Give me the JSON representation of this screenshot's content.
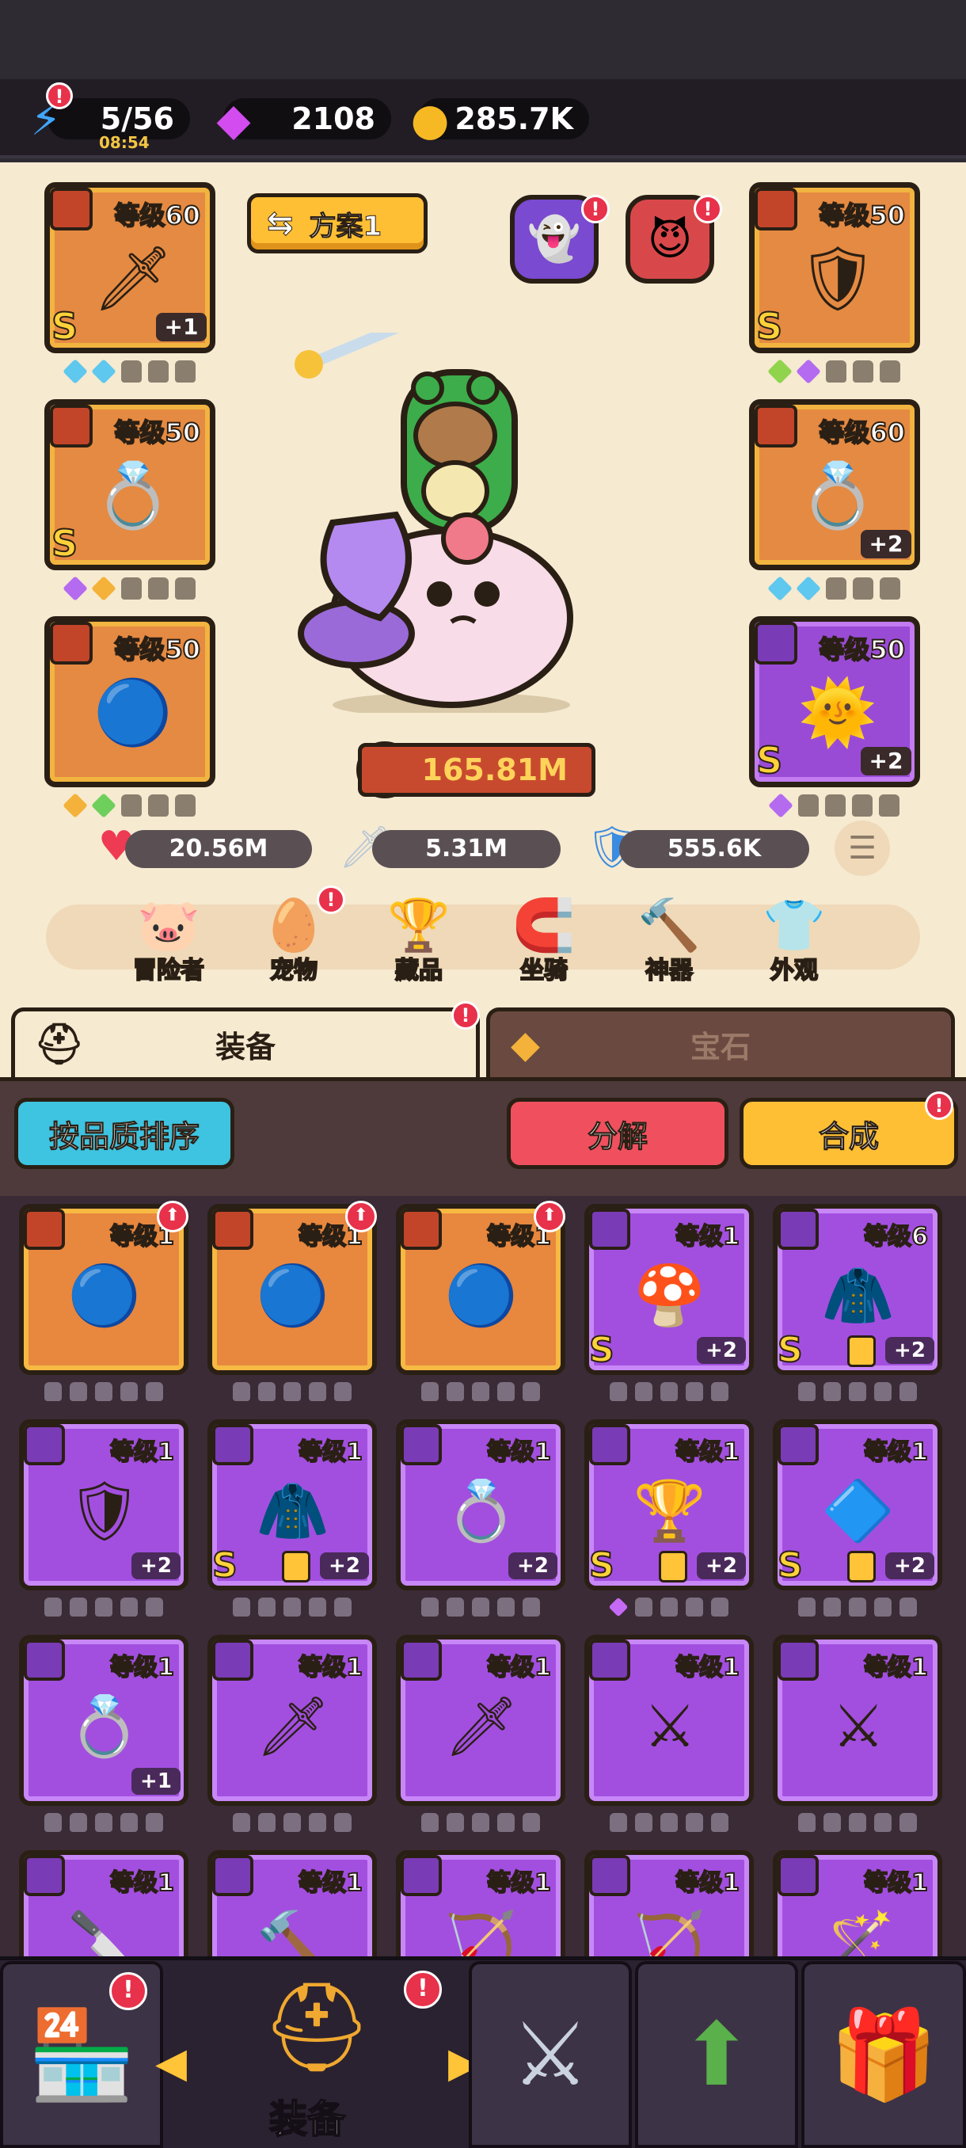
{
  "resources": {
    "energy": {
      "value": "5/56",
      "timer": "08:54",
      "icon": "lightning-icon"
    },
    "gems": {
      "value": "2108",
      "icon": "purple-gem-icon"
    },
    "gold": {
      "value": "285.7K",
      "icon": "gold-coin-icon"
    }
  },
  "plan_button": {
    "label": "方案1",
    "icon": "swap-arrows-icon"
  },
  "equipped_left": [
    {
      "level": "等级60",
      "quality": "S",
      "plus": "+1",
      "art": "dark-sword",
      "gems": [
        "#5ec8ef",
        "#5ec8ef"
      ]
    },
    {
      "level": "等级50",
      "quality": "S",
      "plus": "",
      "art": "gold-ring",
      "gems": [
        "#b46bf0",
        "#f4b23a"
      ]
    },
    {
      "level": "等级50",
      "quality": "",
      "plus": "",
      "art": "blue-orb-amulet",
      "gems": [
        "#f4b23a",
        "#6fcf5c"
      ]
    }
  ],
  "equipped_right": [
    {
      "level": "等级50",
      "quality": "S",
      "plus": "",
      "art": "dark-armor",
      "gems": [
        "#8fd44c",
        "#b46bf0"
      ]
    },
    {
      "level": "等级60",
      "quality": "",
      "plus": "+2",
      "art": "purple-ring",
      "gems": [
        "#5ec8ef",
        "#5ec8ef"
      ]
    },
    {
      "level": "等级50",
      "quality": "S",
      "plus": "+2",
      "art": "sun-medal",
      "gems": [
        "#b46bf0"
      ]
    }
  ],
  "power": {
    "value": "165.81M"
  },
  "stats": {
    "hp": {
      "value": "20.56M",
      "icon": "heart-icon"
    },
    "atk": {
      "value": "5.31M",
      "icon": "sword-icon"
    },
    "def": {
      "value": "555.6K",
      "icon": "shield-icon"
    }
  },
  "nav_menu": [
    {
      "label": "冒险者",
      "icon": "adventurer-icon"
    },
    {
      "label": "宠物",
      "icon": "pet-egg-icon"
    },
    {
      "label": "藏品",
      "icon": "collection-trophy-icon"
    },
    {
      "label": "坐骑",
      "icon": "mount-horseshoe-icon"
    },
    {
      "label": "神器",
      "icon": "artifact-hammer-icon"
    },
    {
      "label": "外观",
      "icon": "appearance-outfit-icon"
    }
  ],
  "tabs": {
    "equipment": "装备",
    "gems": "宝石"
  },
  "toolbar": {
    "sort": "按品质排序",
    "decompose": "分解",
    "merge": "合成"
  },
  "inventory": [
    {
      "level": "等级1",
      "quality": "",
      "plus": "",
      "color": "orange",
      "art": "🔵",
      "up": true,
      "locked": false,
      "gem": false
    },
    {
      "level": "等级1",
      "quality": "",
      "plus": "",
      "color": "orange",
      "art": "🔵",
      "up": true,
      "locked": false,
      "gem": false
    },
    {
      "level": "等级1",
      "quality": "",
      "plus": "",
      "color": "orange",
      "art": "🔵",
      "up": true,
      "locked": false,
      "gem": false
    },
    {
      "level": "等级1",
      "quality": "S",
      "plus": "+2",
      "color": "purple",
      "art": "🍄",
      "up": false,
      "locked": false,
      "gem": false
    },
    {
      "level": "等级6",
      "quality": "S",
      "plus": "+2",
      "color": "purple",
      "art": "🧥",
      "up": false,
      "locked": true,
      "gem": false
    },
    {
      "level": "等级1",
      "quality": "",
      "plus": "+2",
      "color": "purple",
      "art": "🛡",
      "up": false,
      "locked": false,
      "gem": false
    },
    {
      "level": "等级1",
      "quality": "S",
      "plus": "+2",
      "color": "purple",
      "art": "🧥",
      "up": false,
      "locked": true,
      "gem": false
    },
    {
      "level": "等级1",
      "quality": "",
      "plus": "+2",
      "color": "purple",
      "art": "💍",
      "up": false,
      "locked": false,
      "gem": false
    },
    {
      "level": "等级1",
      "quality": "S",
      "plus": "+2",
      "color": "purple",
      "art": "🏆",
      "up": false,
      "locked": true,
      "gem": true
    },
    {
      "level": "等级1",
      "quality": "S",
      "plus": "+2",
      "color": "purple",
      "art": "🔷",
      "up": false,
      "locked": true,
      "gem": false
    },
    {
      "level": "等级1",
      "quality": "",
      "plus": "+1",
      "color": "purple",
      "art": "💍",
      "up": false,
      "locked": false,
      "gem": false
    },
    {
      "level": "等级1",
      "quality": "",
      "plus": "",
      "color": "purple",
      "art": "🗡",
      "up": false,
      "locked": false,
      "gem": false
    },
    {
      "level": "等级1",
      "quality": "",
      "plus": "",
      "color": "purple",
      "art": "🗡",
      "up": false,
      "locked": false,
      "gem": false
    },
    {
      "level": "等级1",
      "quality": "",
      "plus": "",
      "color": "purple",
      "art": "⚔",
      "up": false,
      "locked": false,
      "gem": false
    },
    {
      "level": "等级1",
      "quality": "",
      "plus": "",
      "color": "purple",
      "art": "⚔",
      "up": false,
      "locked": false,
      "gem": false
    },
    {
      "level": "等级1",
      "quality": "",
      "plus": "",
      "color": "purple",
      "art": "🔪",
      "up": false,
      "locked": false,
      "gem": false
    },
    {
      "level": "等级1",
      "quality": "",
      "plus": "",
      "color": "purple",
      "art": "🔨",
      "up": false,
      "locked": false,
      "gem": false
    },
    {
      "level": "等级1",
      "quality": "",
      "plus": "",
      "color": "purple",
      "art": "🏹",
      "up": false,
      "locked": false,
      "gem": false
    },
    {
      "level": "等级1",
      "quality": "",
      "plus": "",
      "color": "purple",
      "art": "🏹",
      "up": false,
      "locked": false,
      "gem": false
    },
    {
      "level": "等级1",
      "quality": "",
      "plus": "",
      "color": "purple",
      "art": "🪄",
      "up": false,
      "locked": false,
      "gem": false
    }
  ],
  "bottom_nav": [
    {
      "icon": "shop-icon"
    },
    {
      "label": "装备",
      "icon": "equipment-helmet-icon"
    },
    {
      "icon": "battle-swords-icon"
    },
    {
      "icon": "upgrade-arrow-icon"
    },
    {
      "icon": "treasure-chest-icon"
    }
  ],
  "colors": {
    "accent_orange": "#ffbf35",
    "red_button": "#f0505e",
    "sort_button": "#3ec3e0",
    "purple_item": "#a24fe0",
    "orange_item": "#e8873e"
  }
}
